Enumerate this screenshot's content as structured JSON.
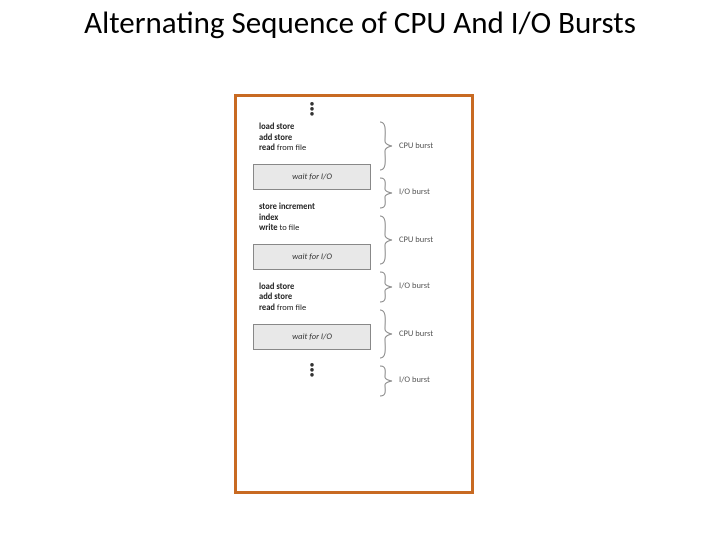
{
  "title": "Alternating Sequence of CPU And I/O Bursts",
  "blocks": {
    "cpu1": {
      "l1a": "load store",
      "l2a": "add store",
      "l3a": "read",
      "l3b": " from file"
    },
    "wait": "wait for I/O",
    "cpu2": {
      "l1a": "store increment",
      "l2a": "index",
      "l3a": "write",
      "l3b": " to file"
    },
    "cpu3": {
      "l1a": "load store",
      "l2a": "add store",
      "l3a": "read",
      "l3b": " from file"
    }
  },
  "labels": {
    "cpu": "CPU burst",
    "io": "I/O burst"
  }
}
